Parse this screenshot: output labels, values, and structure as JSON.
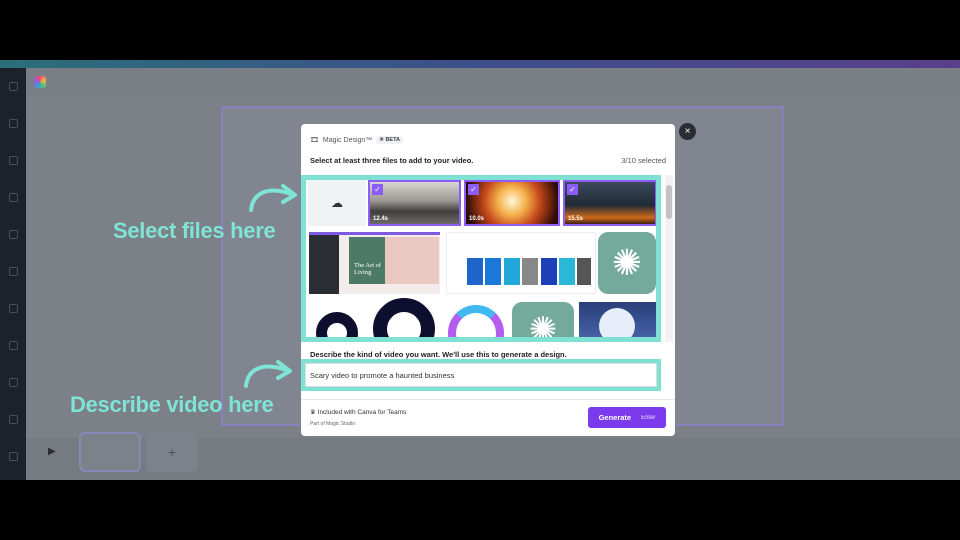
{
  "modal": {
    "title": "Magic Design™",
    "badge": "BETA",
    "instruction": "Select at least three files to add to your video.",
    "selected_count": "3/10 selected",
    "videos": [
      {
        "duration": "12.4s",
        "selected": true
      },
      {
        "duration": "10.0s",
        "selected": true
      },
      {
        "duration": "15.5s",
        "selected": true
      }
    ],
    "image_texts": {
      "art_of_living": "The Art of Living"
    },
    "describe_label": "Describe the kind of video you want. We'll use this to generate a design.",
    "prompt_value": "Scary video to promote a haunted business",
    "included_text": "Included with Canva for Teams",
    "part_of_text": "Part of Magic Studio",
    "generate_label": "Generate",
    "generate_shortcut": "Enter",
    "close": "×"
  },
  "annotations": {
    "select": "Select files here",
    "describe": "Describe video here"
  },
  "colors": {
    "accent": "#7c3aed",
    "annotation": "#7fe3d6",
    "check": "#8b5cf6"
  }
}
